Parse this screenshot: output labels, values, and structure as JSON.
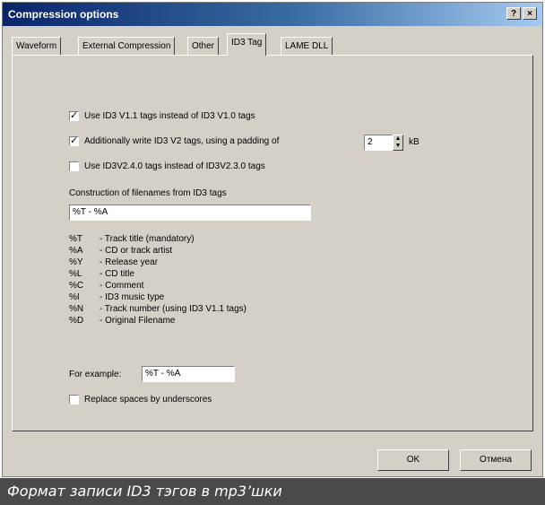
{
  "window": {
    "title": "Compression options",
    "help_btn": "?",
    "close_btn": "×"
  },
  "tabs": [
    {
      "label": "Waveform"
    },
    {
      "label": "External Compression"
    },
    {
      "label": "Other"
    },
    {
      "label": "ID3 Tag"
    },
    {
      "label": "LAME DLL"
    }
  ],
  "options": {
    "use_id3v11": {
      "label": "Use ID3 V1.1 tags instead of ID3 V1.0 tags",
      "checked": true
    },
    "write_id3v2": {
      "label": "Additionally write ID3 V2 tags, using a padding of",
      "checked": true,
      "padding_value": "2",
      "padding_unit": "kB"
    },
    "use_id3v24": {
      "label": "Use ID3V2.4.0 tags instead of ID3V2.3.0 tags",
      "checked": false
    }
  },
  "filenames": {
    "label": "Construction of filenames from ID3 tags",
    "value": "%T - %A"
  },
  "legend": [
    {
      "code": "%T",
      "desc": "- Track title  (mandatory)"
    },
    {
      "code": "%A",
      "desc": "- CD or track artist"
    },
    {
      "code": "%Y",
      "desc": "- Release year"
    },
    {
      "code": "%L",
      "desc": "- CD title"
    },
    {
      "code": "%C",
      "desc": "- Comment"
    },
    {
      "code": "%I",
      "desc": "- ID3 music type"
    },
    {
      "code": "%N",
      "desc": "- Track number  (using ID3 V1.1 tags)"
    },
    {
      "code": "%D",
      "desc": "- Original Filename"
    }
  ],
  "example": {
    "label": "For example:",
    "value": "%T - %A"
  },
  "replace_spaces": {
    "label": "Replace spaces by underscores",
    "checked": false
  },
  "buttons": {
    "ok": "OK",
    "cancel": "Отмена"
  },
  "caption": "Формат записи ID3 тэгов в mp3’шки"
}
